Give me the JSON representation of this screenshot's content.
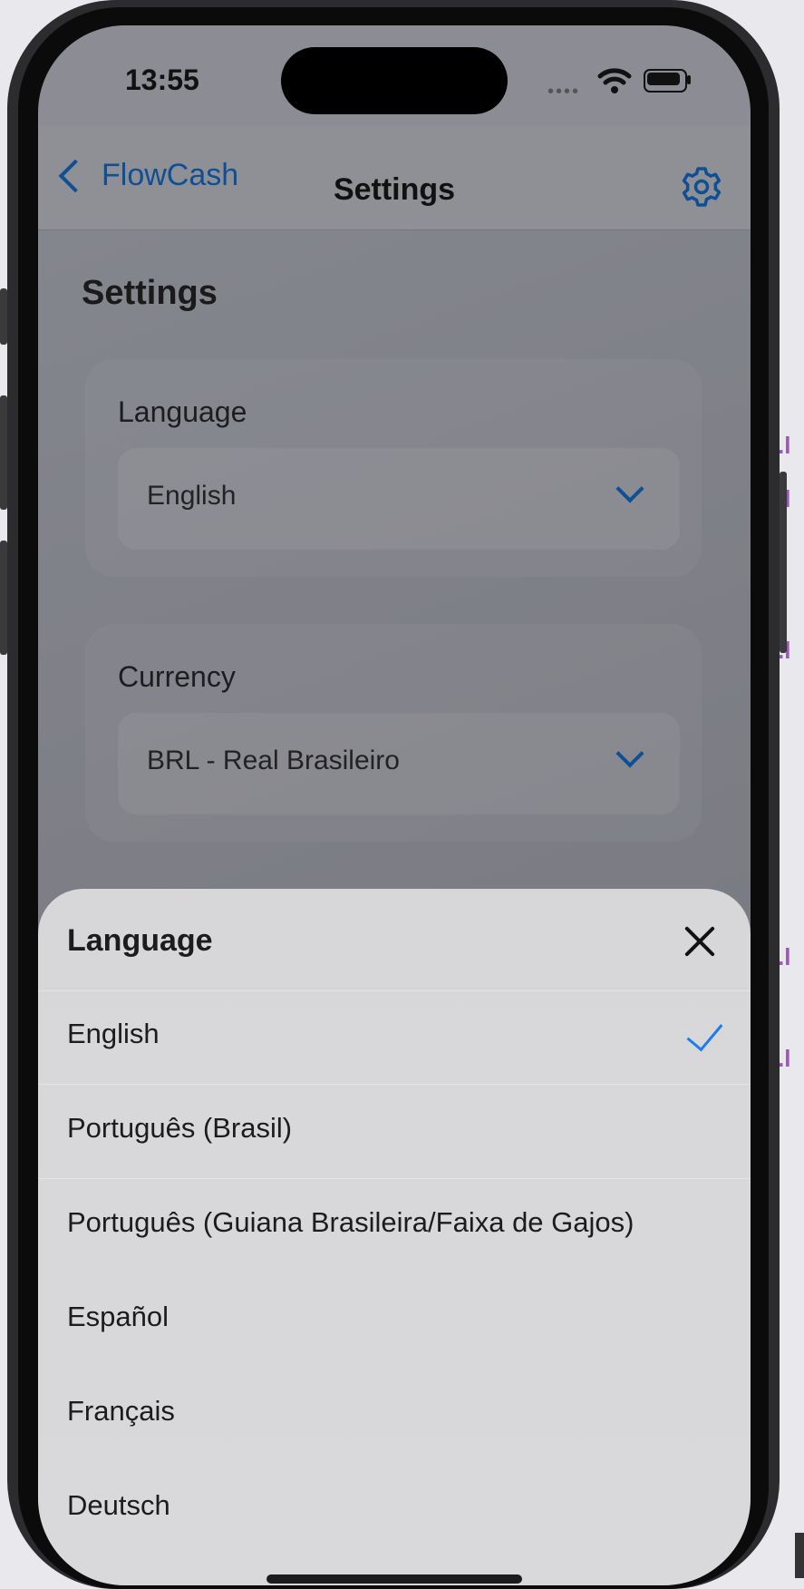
{
  "status_bar": {
    "time": "13:55"
  },
  "nav": {
    "back_label": "FlowCash",
    "title": "Settings"
  },
  "page": {
    "title": "Settings",
    "language_card": {
      "label": "Language",
      "value": "English"
    },
    "currency_card": {
      "label": "Currency",
      "value": "BRL - Real Brasileiro"
    }
  },
  "sheet": {
    "title": "Language",
    "selected": "English",
    "options": [
      {
        "label": "English",
        "selected": true
      },
      {
        "label": "Português (Brasil)",
        "selected": false
      },
      {
        "label": "Português (Guiana Brasileira/Faixa de Gajos)",
        "selected": false
      },
      {
        "label": "Español",
        "selected": false
      },
      {
        "label": "Français",
        "selected": false
      },
      {
        "label": "Deutsch",
        "selected": false
      }
    ]
  },
  "colors": {
    "accent": "#0f4f94",
    "check": "#1a7cf0"
  }
}
